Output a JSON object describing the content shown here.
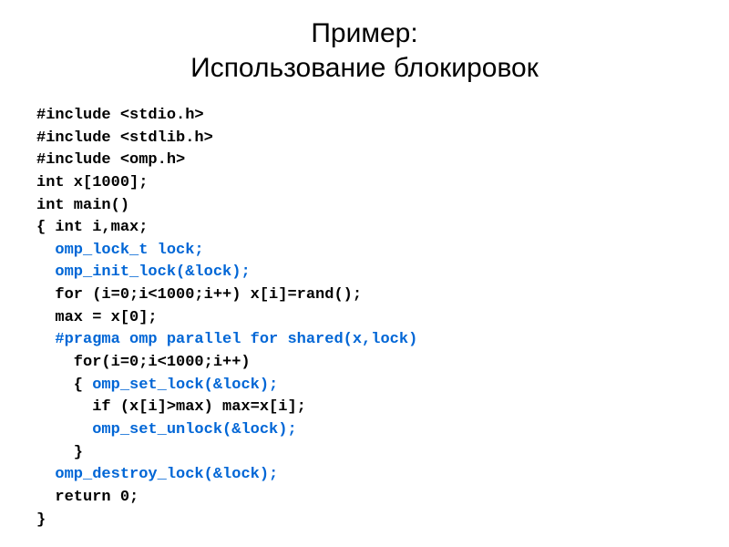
{
  "title_line1": "Пример:",
  "title_line2": "Использование блокировок",
  "code": {
    "l01": "#include <stdio.h>",
    "l02": "#include <stdlib.h>",
    "l03": "#include <omp.h>",
    "l04": "int x[1000];",
    "l05": "int main()",
    "l06": "{ int i,max;",
    "l07a": "  ",
    "l07b": "omp_lock_t lock;",
    "l08a": "  ",
    "l08b": "omp_init_lock(&lock);",
    "l09": "  for (i=0;i<1000;i++) x[i]=rand();",
    "l10": "  max = x[0];",
    "l11a": "  ",
    "l11b": "#pragma omp parallel for shared(x,lock)",
    "l12": "    for(i=0;i<1000;i++)",
    "l13a": "    { ",
    "l13b": "omp_set_lock(&lock);",
    "l14": "      if (x[i]>max) max=x[i];",
    "l15a": "      ",
    "l15b": "omp_set_unlock(&lock);",
    "l16": "    }",
    "l17a": "  ",
    "l17b": "omp_destroy_lock(&lock);",
    "l18": "  return 0;",
    "l19": "}"
  }
}
